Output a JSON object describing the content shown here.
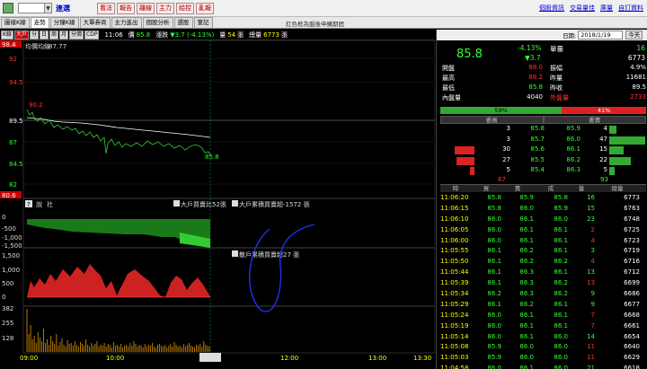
{
  "toolbar": {
    "user_label": "連選",
    "buttons": [
      "看法",
      "報告",
      "離線",
      "主力",
      "給控",
      "亂報"
    ],
    "links": [
      "個股資訊",
      "交易量佳",
      "庫量",
      "自訂資料"
    ]
  },
  "tabs": {
    "items": [
      "圖樣K線",
      "走勢",
      "分鐘K線",
      "大單券商",
      "主力進出",
      "個股分析",
      "選股",
      "筆記"
    ],
    "active_index": 1,
    "message": "紅色框為盤後申購期間"
  },
  "chart_head": {
    "buttons": [
      "K線",
      "大戶",
      "分",
      "日",
      "周",
      "月",
      "分價",
      "CDP"
    ],
    "time": "11:06",
    "price_label": "價",
    "price": "85.8",
    "change_label": "漲跌",
    "change": "▼3.7 (-4.13%)",
    "volume_label": "量",
    "volume": "54",
    "volume_unit": "張",
    "total_label": "總量",
    "total": "6773",
    "total_unit": "張"
  },
  "chart": {
    "avg_label": "均價均線",
    "avg_value": "87.77",
    "price_axis": [
      "98.4",
      "92",
      "94.5",
      "92",
      "89.5",
      "87",
      "84.5",
      "82",
      "80.6"
    ],
    "high_mark": "90.2",
    "last_label": "85.8",
    "panel2_btns": [
      "?",
      "說",
      "社"
    ],
    "panel2_label1": "大戶買賣比52張",
    "panel2_label2": "大戶累積買賣超-1572 張",
    "panel2_axis": [
      "0",
      "-500",
      "-1,000",
      "-1,500"
    ],
    "panel3_label": "散戶累積買賣超27 張",
    "panel3_axis": [
      "1,500",
      "1,000",
      "500",
      "0"
    ],
    "panel4_axis": [
      "382",
      "255",
      "128"
    ],
    "time_axis": [
      "09:00",
      "10:00",
      "11:06",
      "12:00",
      "13:00",
      "13:30"
    ]
  },
  "right_panel": {
    "date_label": "日期:",
    "date_value": "2018/1/19",
    "today_label": "今天",
    "price": "85.8",
    "change_pct": "-4.13%",
    "change_abs": "▼3.7",
    "unit_label": "單量",
    "unit_value": "16",
    "total_value": "6773",
    "stats": [
      {
        "l": "開盤",
        "v": "88.0",
        "vc": "red",
        "l2": "振幅",
        "v2": "4.9%",
        "v2c": "wht"
      },
      {
        "l": "最高",
        "v": "88.2",
        "vc": "red",
        "l2": "昨量",
        "v2": "11681",
        "v2c": "wht"
      },
      {
        "l": "最低",
        "v": "85.8",
        "vc": "grn",
        "l2": "昨收",
        "v2": "89.5",
        "v2c": "wht"
      },
      {
        "l": "內盤量",
        "v": "4040",
        "vc": "wht",
        "l2": "外盤量",
        "v2": "2733",
        "v2c": "red"
      }
    ],
    "ratio_green": "59%",
    "ratio_red": "41%",
    "ob_head": [
      "委買",
      "委賣"
    ],
    "orderbook": [
      {
        "bq": "3",
        "bp": "85.8",
        "ap": "85.9",
        "aq": "4",
        "bbar": 0,
        "abar": 8
      },
      {
        "bq": "3",
        "bp": "85.7",
        "ap": "86.0",
        "aq": "47",
        "bbar": 0,
        "abar": 48
      },
      {
        "bq": "30",
        "bp": "85.6",
        "ap": "86.1",
        "aq": "15",
        "bbar": 22,
        "abar": 16
      },
      {
        "bq": "27",
        "bp": "85.5",
        "ap": "86.2",
        "aq": "22",
        "bbar": 20,
        "abar": 24
      },
      {
        "bq": "5",
        "bp": "85.4",
        "ap": "86.3",
        "aq": "5",
        "bbar": 5,
        "abar": 6
      }
    ],
    "ob_totals": {
      "bid": "67",
      "ask": "93"
    },
    "trade_head": [
      "時",
      "買",
      "賣",
      "成",
      "量",
      "總量"
    ],
    "trades": [
      {
        "t": "11:06:20",
        "b": "85.8",
        "a": "85.9",
        "p": "85.8",
        "q": "16",
        "v": "6773",
        "pc": "grn",
        "qc": "grn"
      },
      {
        "t": "11:06:15",
        "b": "85.8",
        "a": "86.0",
        "p": "85.9",
        "q": "15",
        "v": "6763",
        "pc": "grn",
        "qc": "grn"
      },
      {
        "t": "11:06:10",
        "b": "86.0",
        "a": "86.1",
        "p": "86.0",
        "q": "23",
        "v": "6748",
        "pc": "grn",
        "qc": "grn"
      },
      {
        "t": "11:06:05",
        "b": "86.0",
        "a": "86.1",
        "p": "86.1",
        "q": "2",
        "v": "6725",
        "pc": "grn",
        "qc": "red"
      },
      {
        "t": "11:06:00",
        "b": "86.0",
        "a": "86.1",
        "p": "86.1",
        "q": "4",
        "v": "6723",
        "pc": "grn",
        "qc": "red"
      },
      {
        "t": "11:05:55",
        "b": "86.1",
        "a": "86.2",
        "p": "86.1",
        "q": "3",
        "v": "6719",
        "pc": "grn",
        "qc": "grn"
      },
      {
        "t": "11:05:50",
        "b": "86.1",
        "a": "86.2",
        "p": "86.2",
        "q": "4",
        "v": "6716",
        "pc": "grn",
        "qc": "red"
      },
      {
        "t": "11:05:44",
        "b": "86.1",
        "a": "86.3",
        "p": "86.1",
        "q": "13",
        "v": "6712",
        "pc": "grn",
        "qc": "grn"
      },
      {
        "t": "11:05:39",
        "b": "86.1",
        "a": "86.3",
        "p": "86.2",
        "q": "13",
        "v": "6699",
        "pc": "grn",
        "qc": "red"
      },
      {
        "t": "11:05:34",
        "b": "86.2",
        "a": "86.3",
        "p": "86.2",
        "q": "9",
        "v": "6686",
        "pc": "grn",
        "qc": "grn"
      },
      {
        "t": "11:05:29",
        "b": "86.1",
        "a": "86.2",
        "p": "86.1",
        "q": "9",
        "v": "6677",
        "pc": "grn",
        "qc": "grn"
      },
      {
        "t": "11:05:24",
        "b": "86.0",
        "a": "86.1",
        "p": "86.1",
        "q": "7",
        "v": "6668",
        "pc": "grn",
        "qc": "red"
      },
      {
        "t": "11:05:19",
        "b": "86.0",
        "a": "86.1",
        "p": "86.1",
        "q": "7",
        "v": "6661",
        "pc": "grn",
        "qc": "red"
      },
      {
        "t": "11:05:14",
        "b": "86.0",
        "a": "86.1",
        "p": "86.0",
        "q": "14",
        "v": "6654",
        "pc": "grn",
        "qc": "grn"
      },
      {
        "t": "11:05:08",
        "b": "85.9",
        "a": "86.0",
        "p": "86.0",
        "q": "11",
        "v": "6640",
        "pc": "grn",
        "qc": "red"
      },
      {
        "t": "11:05:03",
        "b": "85.9",
        "a": "86.0",
        "p": "86.0",
        "q": "11",
        "v": "6629",
        "pc": "grn",
        "qc": "red"
      },
      {
        "t": "11:04:58",
        "b": "86.0",
        "a": "86.1",
        "p": "86.0",
        "q": "21",
        "v": "6618",
        "pc": "grn",
        "qc": "grn"
      }
    ]
  }
}
